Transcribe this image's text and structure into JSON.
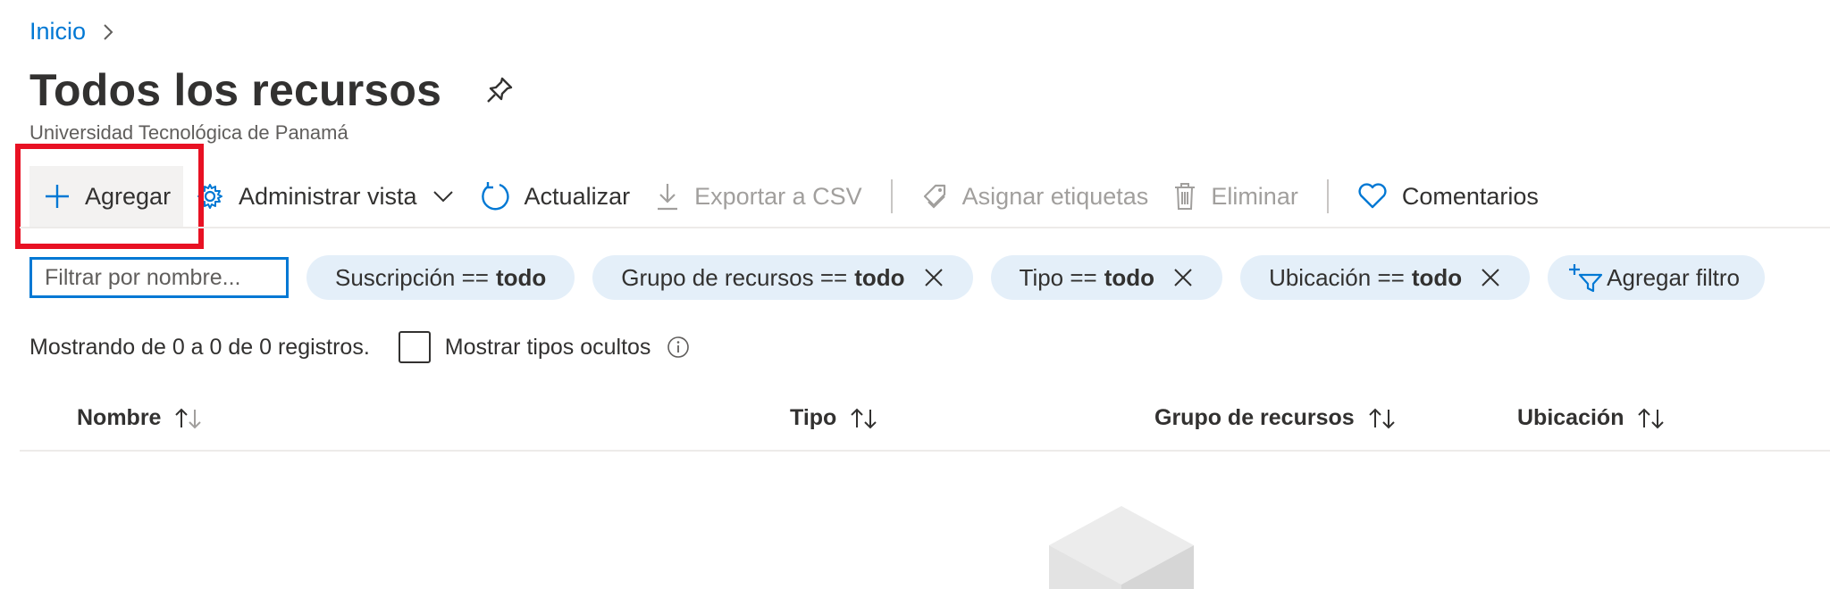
{
  "breadcrumb": {
    "home": "Inicio"
  },
  "page": {
    "title": "Todos los recursos",
    "subtitle": "Universidad Tecnológica de Panamá"
  },
  "toolbar": {
    "add": "Agregar",
    "manage_view": "Administrar vista",
    "refresh": "Actualizar",
    "export_csv": "Exportar a CSV",
    "assign_tags": "Asignar etiquetas",
    "delete": "Eliminar",
    "feedback": "Comentarios"
  },
  "filters": {
    "search_placeholder": "Filtrar por nombre...",
    "pills": [
      {
        "label": "Suscripción ==",
        "value": "todo"
      },
      {
        "label": "Grupo de recursos ==",
        "value": "todo"
      },
      {
        "label": "Tipo ==",
        "value": "todo"
      },
      {
        "label": "Ubicación ==",
        "value": "todo"
      }
    ],
    "add_filter": "Agregar filtro"
  },
  "status": {
    "records": "Mostrando de 0 a 0 de 0 registros.",
    "show_hidden": "Mostrar tipos ocultos"
  },
  "table": {
    "columns": [
      "Nombre",
      "Tipo",
      "Grupo de recursos",
      "Ubicación"
    ]
  },
  "colors": {
    "accent": "#0078d4",
    "pill_bg": "#e4eff9",
    "highlight": "#e81123"
  },
  "icons": [
    "chevron-right-icon",
    "pin-icon",
    "plus-icon",
    "gear-icon",
    "chevron-down-icon",
    "refresh-icon",
    "download-icon",
    "tag-icon",
    "trash-icon",
    "heart-icon",
    "close-icon",
    "add-filter-icon",
    "info-icon",
    "sort-icon",
    "empty-cube-icon"
  ]
}
